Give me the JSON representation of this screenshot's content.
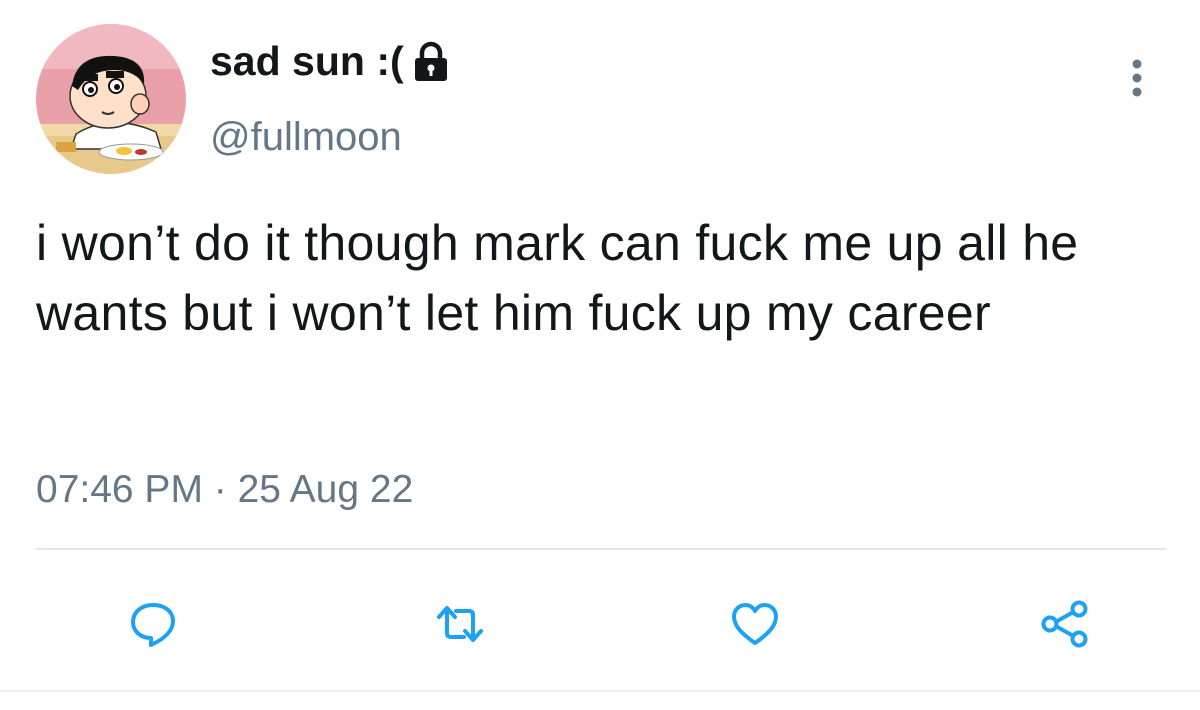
{
  "user": {
    "display_name": "sad sun :(",
    "handle": "@fullmoon",
    "locked_icon": "lock-icon",
    "avatar": "avatar-cartoon-boy"
  },
  "tweet": {
    "text": "i won’t do it though mark can fuck me up all he wants but i won’t let him fuck up my career",
    "timestamp": "07:46 PM · 25 Aug 22"
  },
  "actions": [
    {
      "name": "reply",
      "icon": "comment-icon"
    },
    {
      "name": "retweet",
      "icon": "retweet-icon"
    },
    {
      "name": "like",
      "icon": "heart-icon"
    },
    {
      "name": "share",
      "icon": "share-icon"
    }
  ],
  "colors": {
    "text": "#14171a",
    "secondary": "#657786",
    "accent": "#1da1f2",
    "divider": "#e1e8ed"
  }
}
